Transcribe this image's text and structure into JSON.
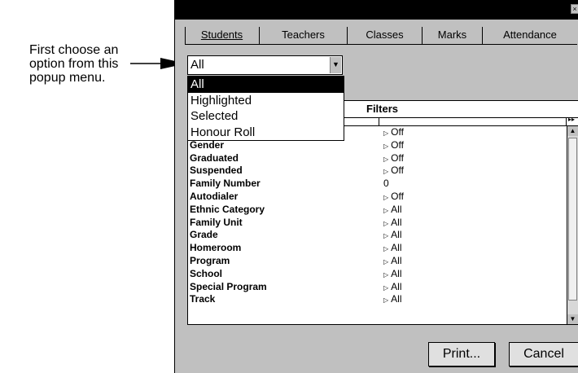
{
  "callout": {
    "lines": [
      "First choose an",
      "option from this",
      "popup menu."
    ]
  },
  "window": {
    "close_glyph": "×"
  },
  "tabs": [
    {
      "label": "Students",
      "active": true
    },
    {
      "label": "Teachers"
    },
    {
      "label": "Classes"
    },
    {
      "label": "Marks"
    },
    {
      "label": "Attendance"
    }
  ],
  "popup": {
    "value": "All",
    "options": [
      "All",
      "Highlighted",
      "Selected",
      "Honour Roll"
    ],
    "selected_index": 0
  },
  "table": {
    "header": "Filters",
    "rows": [
      {
        "name": "",
        "value": "Off",
        "arrow": true
      },
      {
        "name": "Gender",
        "value": "Off",
        "arrow": true
      },
      {
        "name": "Graduated",
        "value": "Off",
        "arrow": true
      },
      {
        "name": "Suspended",
        "value": "Off",
        "arrow": true
      },
      {
        "name": "Family Number",
        "value": "0",
        "arrow": false
      },
      {
        "name": "Autodialer",
        "value": "Off",
        "arrow": true
      },
      {
        "name": "Ethnic Category",
        "value": "All",
        "arrow": true
      },
      {
        "name": "Family Unit",
        "value": "All",
        "arrow": true
      },
      {
        "name": "Grade",
        "value": "All",
        "arrow": true
      },
      {
        "name": "Homeroom",
        "value": "All",
        "arrow": true
      },
      {
        "name": "Program",
        "value": "All",
        "arrow": true
      },
      {
        "name": "School",
        "value": "All",
        "arrow": true
      },
      {
        "name": "Special Program",
        "value": "All",
        "arrow": true
      },
      {
        "name": "Track",
        "value": "All",
        "arrow": true
      }
    ]
  },
  "buttons": {
    "print": "Print...",
    "cancel": "Cancel"
  }
}
